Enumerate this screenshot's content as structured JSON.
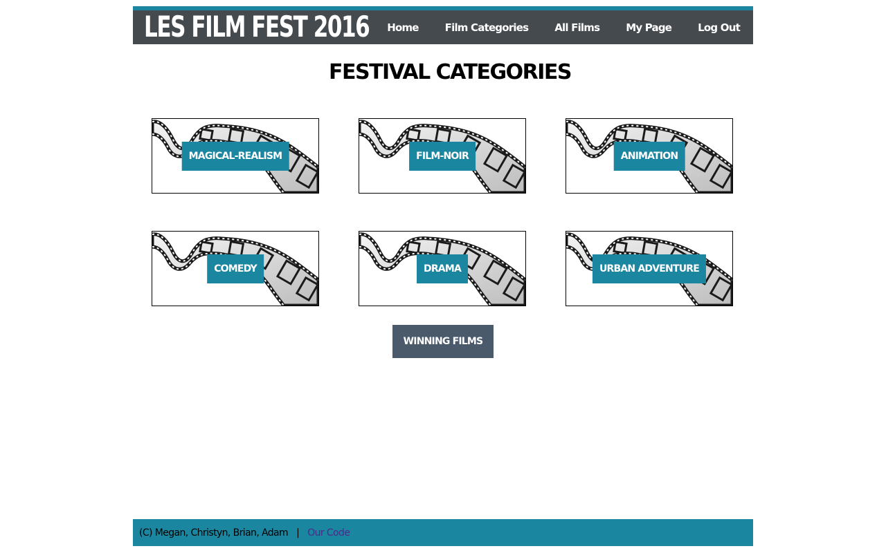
{
  "header": {
    "site_title": "LES FILM FEST 2016",
    "nav": [
      "Home",
      "Film Categories",
      "All Films",
      "My Page",
      "Log Out"
    ]
  },
  "main": {
    "title": "FESTIVAL CATEGORIES",
    "categories": [
      "MAGICAL-REALISM",
      "FILM-NOIR",
      "ANIMATION",
      "COMEDY",
      "DRAMA",
      "URBAN ADVENTURE"
    ],
    "card_image_icon": "film-strip-icon",
    "winning_button": "WINNING FILMS"
  },
  "footer": {
    "credits": "(C) Megan, Christyn, Brian, Adam",
    "separator": "|",
    "link": "Our Code"
  },
  "colors": {
    "accent_teal": "#1b86a0",
    "header_dark": "#454a4f",
    "button_slate": "#4a5a6b",
    "link_purple": "#4b2a8a"
  }
}
